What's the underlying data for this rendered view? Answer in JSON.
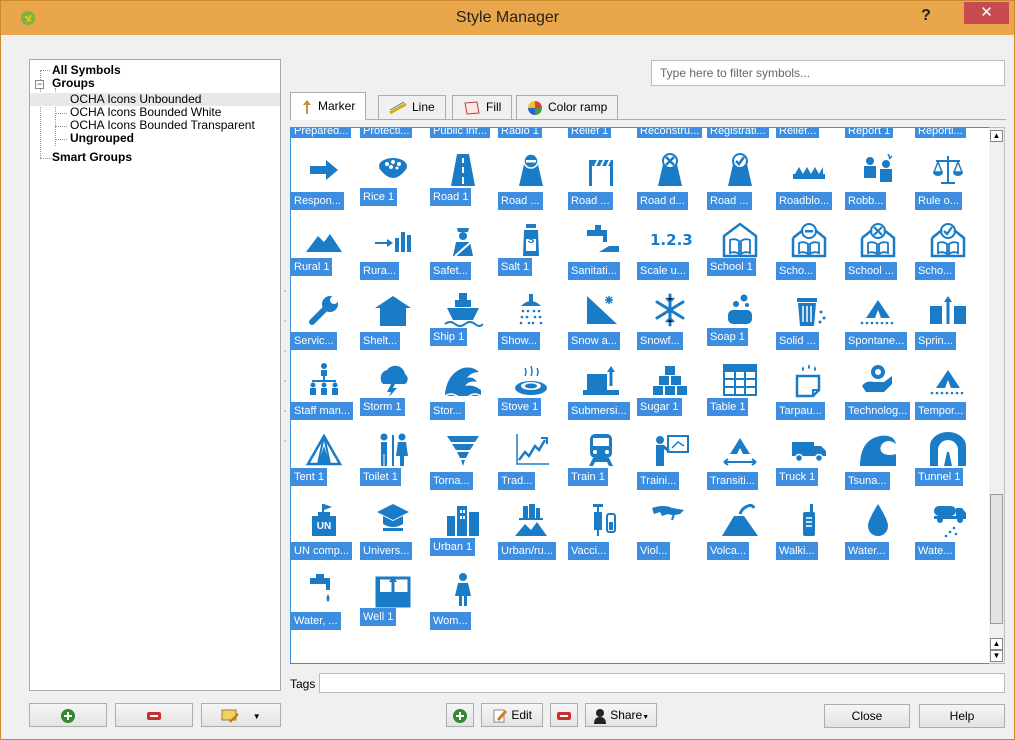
{
  "window": {
    "title": "Style Manager",
    "help_label": "?",
    "close_label": "✕"
  },
  "tree": {
    "all_symbols": "All Symbols",
    "groups": "Groups",
    "group_items": [
      "OCHA Icons Unbounded",
      "OCHA Icons Bounded White",
      "OCHA Icons Bounded Transparent"
    ],
    "ungrouped": "Ungrouped",
    "smart_groups": "Smart Groups",
    "expander_minus": "−"
  },
  "filter": {
    "placeholder": "Type here to filter symbols..."
  },
  "tabs": [
    {
      "label": "Marker",
      "icon": "marker-icon",
      "active": true
    },
    {
      "label": "Line",
      "icon": "line-icon",
      "active": false
    },
    {
      "label": "Fill",
      "icon": "fill-icon",
      "active": false
    },
    {
      "label": "Color ramp",
      "icon": "color-ramp-icon",
      "active": false
    }
  ],
  "symbols_top_partial": [
    "Prepared...",
    "Protecti...",
    "Public inf...",
    "Radio 1",
    "Relief 1",
    "Reconstru...",
    "Registrati...",
    "Relief...",
    "Report 1",
    "Reporti..."
  ],
  "symbols": [
    [
      "Respon...",
      "Rice 1",
      "Road 1",
      "Road ...",
      "Road ...",
      "Road d...",
      "Road ...",
      "Roadblo...",
      "Robb...",
      "Rule o..."
    ],
    [
      "Rural 1",
      "Rura...",
      "Safet...",
      "Salt 1",
      "Sanitati...",
      "Scale u...",
      "School 1",
      "Scho...",
      "School ...",
      "Scho..."
    ],
    [
      "Servic...",
      "Shelt...",
      "Ship 1",
      "Show...",
      "Snow a...",
      "Snowf...",
      "Soap 1",
      "Solid ...",
      "Spontane...",
      "Sprin..."
    ],
    [
      "Staff man...",
      "Storm 1",
      "Stor...",
      "Stove 1",
      "Submersi...",
      "Sugar 1",
      "Table 1",
      "Tarpau...",
      "Technolog...",
      "Tempor..."
    ],
    [
      "Tent 1",
      "Toilet 1",
      "Torna...",
      "Trad...",
      "Train 1",
      "Traini...",
      "Transiti...",
      "Truck 1",
      "Tsuna...",
      "Tunnel 1"
    ],
    [
      "UN comp...",
      "Univers...",
      "Urban 1",
      "Urban/ru...",
      "Vacci...",
      "Viol...",
      "Volca...",
      "Walki...",
      "Water...",
      "Wate..."
    ],
    [
      "Water, ...",
      "Well 1",
      "Wom..."
    ]
  ],
  "symbol_icon_text": {
    "scale": "1.2.3",
    "salt": "S",
    "un": "UN"
  },
  "tags": {
    "label": "Tags",
    "value": ""
  },
  "buttons": {
    "edit": "Edit",
    "share": "Share",
    "close": "Close",
    "help": "Help"
  },
  "colors": {
    "accent": "#3d8ee0",
    "icon": "#1a7bc6",
    "titlebar": "#eaa64a",
    "close": "#c74b50"
  }
}
